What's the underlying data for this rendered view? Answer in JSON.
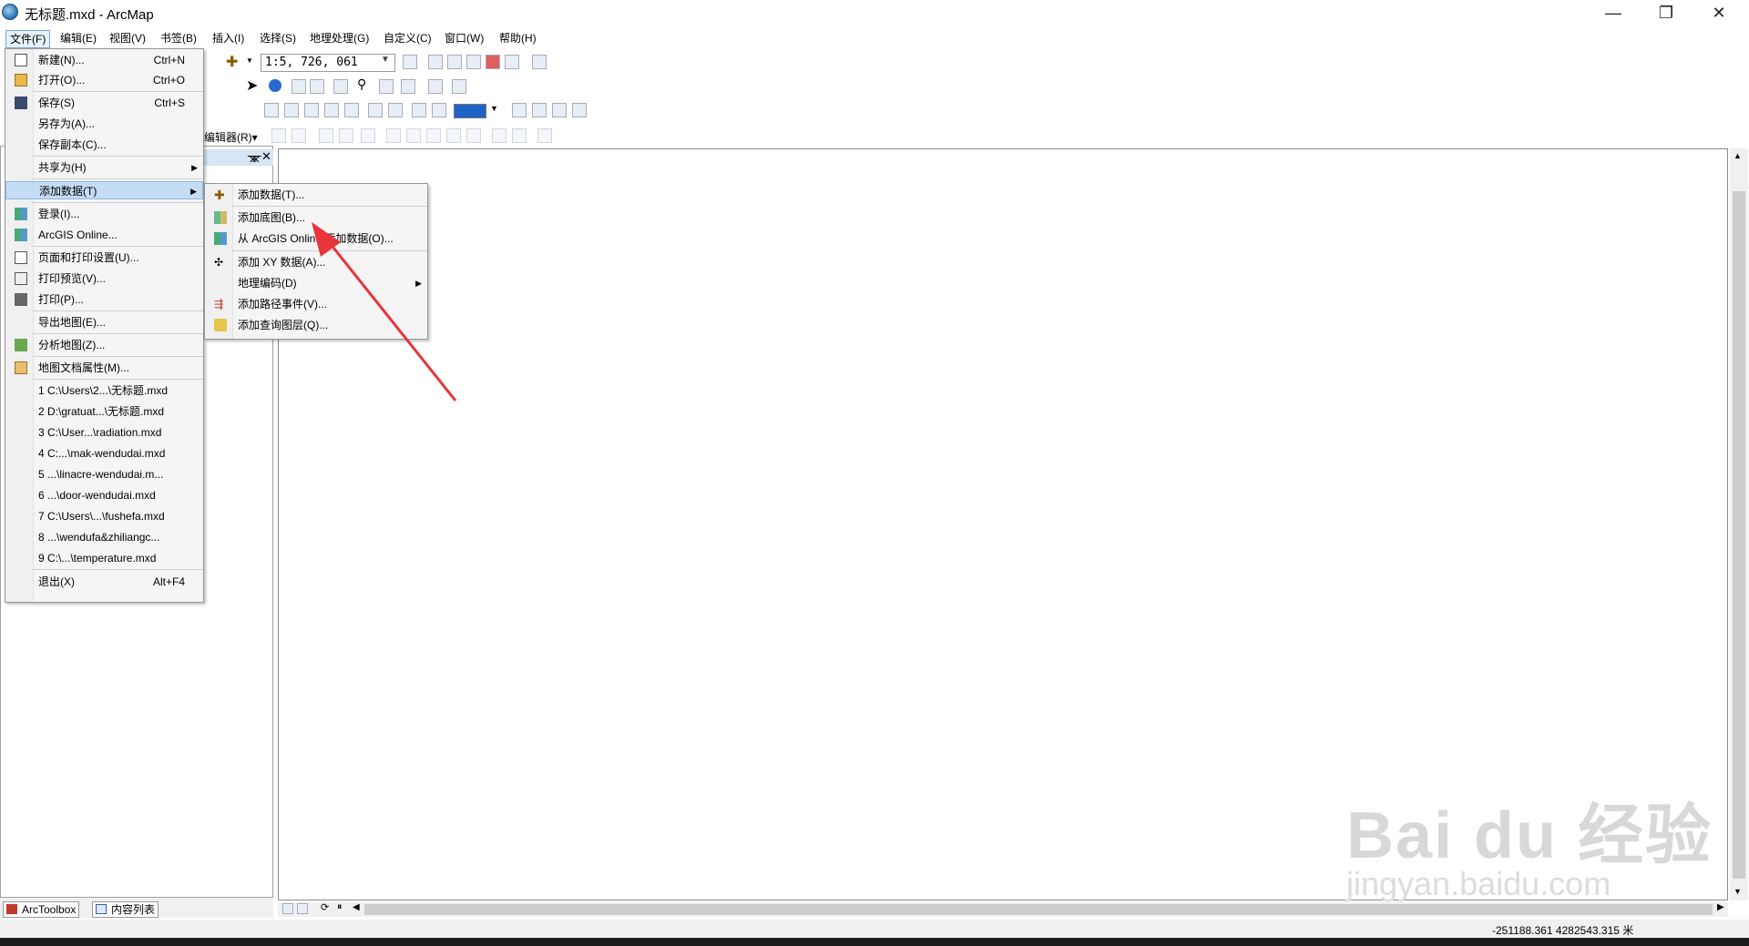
{
  "window": {
    "title": "无标题.mxd - ArcMap",
    "minimize_glyph": "—",
    "restore_glyph": "❐",
    "close_glyph": "✕"
  },
  "menubar": [
    {
      "label": "文件(F)"
    },
    {
      "label": "编辑(E)"
    },
    {
      "label": "视图(V)"
    },
    {
      "label": "书签(B)"
    },
    {
      "label": "插入(I)"
    },
    {
      "label": "选择(S)"
    },
    {
      "label": "地理处理(G)"
    },
    {
      "label": "自定义(C)"
    },
    {
      "label": "窗口(W)"
    },
    {
      "label": "帮助(H)"
    }
  ],
  "toolbar": {
    "scale": "1:5, 726, 061",
    "editor_label": "编辑器(R)▾"
  },
  "toc": {
    "pin_glyph": "ᚘ",
    "close_glyph": "✕",
    "tabs": [
      "ArcToolbox",
      "内容列表"
    ]
  },
  "file_menu": [
    {
      "label": "新建(N)...",
      "shortcut": "Ctrl+N",
      "icon": "new-document-icon"
    },
    {
      "label": "打开(O)...",
      "shortcut": "Ctrl+O",
      "icon": "open-folder-icon"
    },
    {
      "label": "保存(S)",
      "shortcut": "Ctrl+S",
      "icon": "save-icon"
    },
    {
      "label": "另存为(A)...",
      "shortcut": ""
    },
    {
      "label": "保存副本(C)...",
      "shortcut": ""
    },
    {
      "label": "共享为(H)",
      "shortcut": "",
      "submenu": true
    },
    {
      "label": "添加数据(T)",
      "shortcut": "",
      "submenu": true,
      "highlighted": true
    },
    {
      "label": "登录(I)...",
      "shortcut": "",
      "icon": "grid-icon"
    },
    {
      "label": "ArcGIS Online...",
      "shortcut": "",
      "icon": "grid-icon"
    },
    {
      "label": "页面和打印设置(U)...",
      "shortcut": "",
      "icon": "page-setup-icon"
    },
    {
      "label": "打印预览(V)...",
      "shortcut": "",
      "icon": "print-preview-icon"
    },
    {
      "label": "打印(P)...",
      "shortcut": "",
      "icon": "printer-icon"
    },
    {
      "label": "导出地图(E)...",
      "shortcut": ""
    },
    {
      "label": "分析地图(Z)...",
      "shortcut": "",
      "icon": "analyze-icon"
    },
    {
      "label": "地图文档属性(M)...",
      "shortcut": "",
      "icon": "properties-icon"
    },
    {
      "label": "1 C:\\Users\\2...\\无标题.mxd",
      "shortcut": ""
    },
    {
      "label": "2 D:\\gratuat...\\无标题.mxd",
      "shortcut": ""
    },
    {
      "label": "3 C:\\User...\\radiation.mxd",
      "shortcut": ""
    },
    {
      "label": "4 C:...\\mak-wendudai.mxd",
      "shortcut": ""
    },
    {
      "label": "5 ...\\linacre-wendudai.m...",
      "shortcut": ""
    },
    {
      "label": "6 ...\\door-wendudai.mxd",
      "shortcut": ""
    },
    {
      "label": "7 C:\\Users\\...\\fushefa.mxd",
      "shortcut": ""
    },
    {
      "label": "8 ...\\wendufa&zhiliangc...",
      "shortcut": ""
    },
    {
      "label": "9 C:\\...\\temperature.mxd",
      "shortcut": ""
    },
    {
      "label": "退出(X)",
      "shortcut": "Alt+F4"
    }
  ],
  "add_data_menu": [
    {
      "label": "添加数据(T)...",
      "icon": "add-data-icon"
    },
    {
      "label": "添加底图(B)...",
      "icon": "basemap-icon"
    },
    {
      "label": "从 ArcGIS Online 添加数据(O)...",
      "icon": "grid-icon"
    },
    {
      "label": "添加 XY 数据(A)...",
      "icon": "xy-data-icon"
    },
    {
      "label": "地理编码(D)",
      "submenu": true
    },
    {
      "label": "添加路径事件(V)...",
      "icon": "route-events-icon"
    },
    {
      "label": "添加查询图层(Q)...",
      "icon": "query-layer-icon"
    }
  ],
  "statusbar": {
    "coordinates": "-251188.361  4282543.315 米"
  },
  "colors": {
    "menu_highlight": "#c5dcf5",
    "annotation_arrow": "#e8343a",
    "swatch": "#1f63c8"
  }
}
